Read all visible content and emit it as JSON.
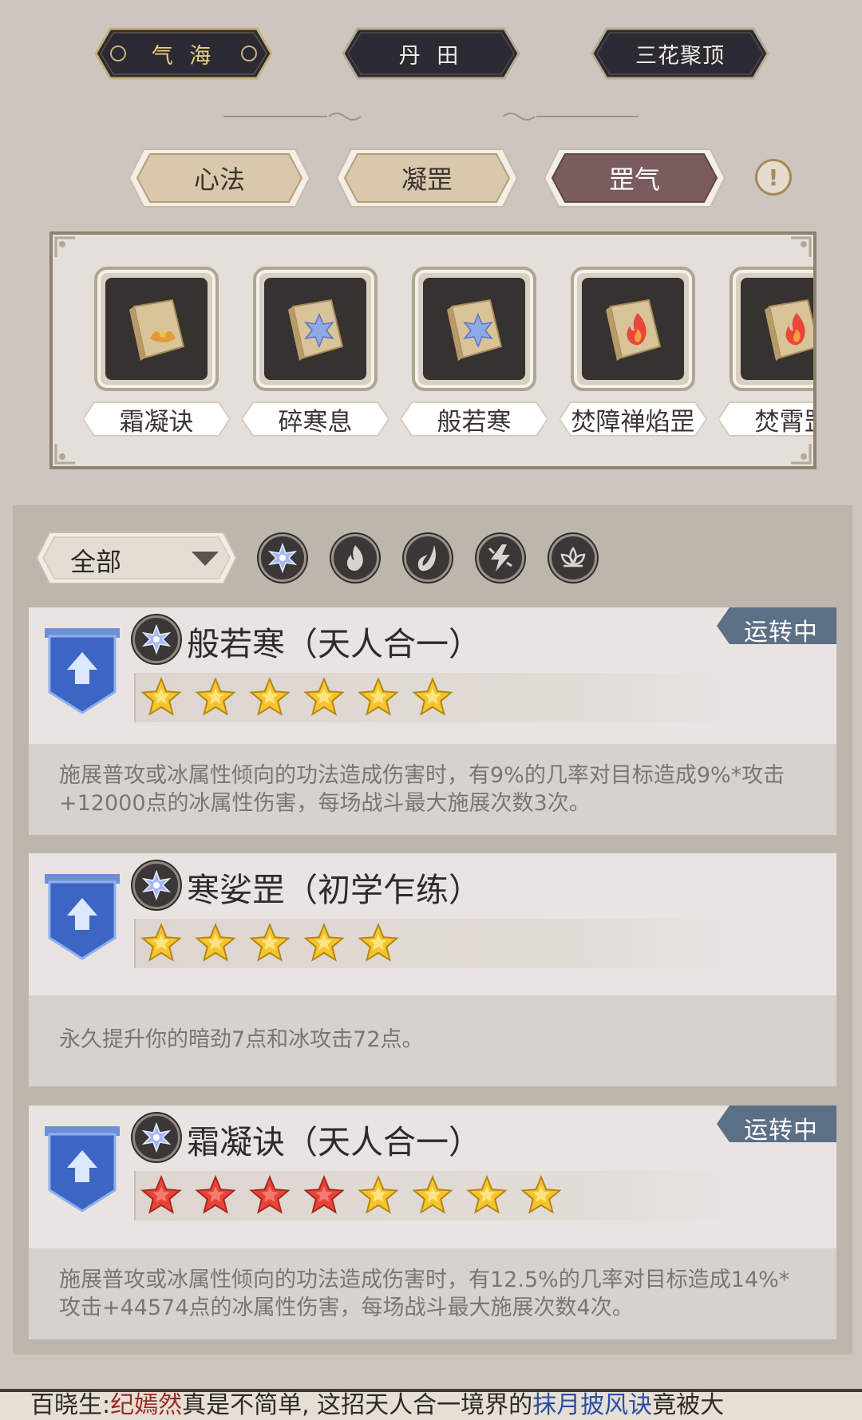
{
  "top_tabs": [
    {
      "label": "气 海",
      "active": true
    },
    {
      "label": "丹 田",
      "active": false
    },
    {
      "label": "三花聚顶",
      "active": false
    }
  ],
  "sub_tabs": [
    {
      "label": "心法",
      "active": false
    },
    {
      "label": "凝罡",
      "active": false
    },
    {
      "label": "罡气",
      "active": true
    }
  ],
  "info_button": "!",
  "equipped": [
    {
      "name": "霜凝诀",
      "icon": "lotus-book-icon"
    },
    {
      "name": "碎寒息",
      "icon": "ice-book-icon"
    },
    {
      "name": "般若寒",
      "icon": "ice-book-icon"
    },
    {
      "name": "焚障禅焰罡",
      "icon": "fire-book-icon"
    },
    {
      "name": "焚霄罡",
      "icon": "fire-book-icon"
    }
  ],
  "filter": {
    "selected": "全部",
    "elements": [
      "ice-icon",
      "fire-icon",
      "poison-icon",
      "thunder-icon",
      "lotus-icon"
    ]
  },
  "cards": [
    {
      "title": "般若寒（天人合一）",
      "element": "ice-icon",
      "running": "运转中",
      "red_stars": 0,
      "gold_stars": 6,
      "description": "施展普攻或冰属性倾向的功法造成伤害时，有9%的几率对目标造成9%*攻击+12000点的冰属性伤害，每场战斗最大施展次数3次。"
    },
    {
      "title": "寒娑罡（初学乍练）",
      "element": "ice-icon",
      "running": "",
      "red_stars": 0,
      "gold_stars": 5,
      "description": "永久提升你的暗劲7点和冰攻击72点。"
    },
    {
      "title": "霜凝诀（天人合一）",
      "element": "ice-icon",
      "running": "运转中",
      "red_stars": 4,
      "gold_stars": 4,
      "description": "施展普攻或冰属性倾向的功法造成伤害时，有12.5%的几率对目标造成14%*攻击+44574点的冰属性伤害，每场战斗最大施展次数4次。"
    }
  ],
  "chat": {
    "sender": "百晓生:",
    "name1": "纪嫣然",
    "text1": "真是不简单, 这招天人合一境界的",
    "name2": "抹月披风诀",
    "text2": "竟被大"
  },
  "colors": {
    "accent_active_tab": "#7a5c5e",
    "gold_text": "#e9cf7c",
    "running_tag": "#5b6f86",
    "rank_badge": "#3d66c4"
  }
}
